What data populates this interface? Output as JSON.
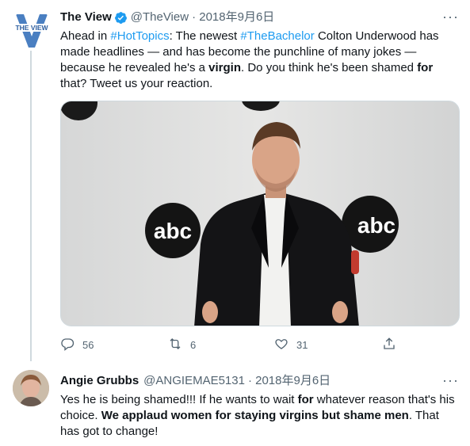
{
  "tweet1": {
    "author_name": "The View",
    "author_handle": "@TheView",
    "date": "· 2018年9月6日",
    "avatar_text": "THE VIEW",
    "more": "···",
    "text": {
      "p1": "Ahead in ",
      "tag1": "#HotTopics",
      "p2": ": The newest ",
      "tag2": "#TheBachelor",
      "p3": " Colton Underwood has made headlines — and has become the punchline of many jokes — because he revealed he's a ",
      "b1": "virgin",
      "p4": ". Do you think he's been shamed ",
      "b2": "for",
      "p5": " that? Tweet us your reaction."
    },
    "media": {
      "logo_left": "abc",
      "logo_right": "abc"
    },
    "actions": {
      "reply_count": "56",
      "retweet_count": "6",
      "like_count": "31"
    }
  },
  "tweet2": {
    "author_name": "Angie Grubbs",
    "author_handle": "@ANGIEMAE5131",
    "date": "· 2018年9月6日",
    "more": "···",
    "text": {
      "p1": "Yes he is being shamed!!! If he wants to wait ",
      "b1": "for",
      "p2": " whatever reason that's his choice. ",
      "b2": "We applaud women for staying virgins but shame men",
      "p3": ". That has got to change!"
    }
  },
  "colors": {
    "link": "#1d9bf0",
    "verified": "#1d9bf0",
    "muted": "#536471",
    "text": "#0f1419"
  },
  "icons": [
    "verified-icon",
    "more-icon",
    "reply-icon",
    "retweet-icon",
    "like-icon",
    "share-icon"
  ]
}
